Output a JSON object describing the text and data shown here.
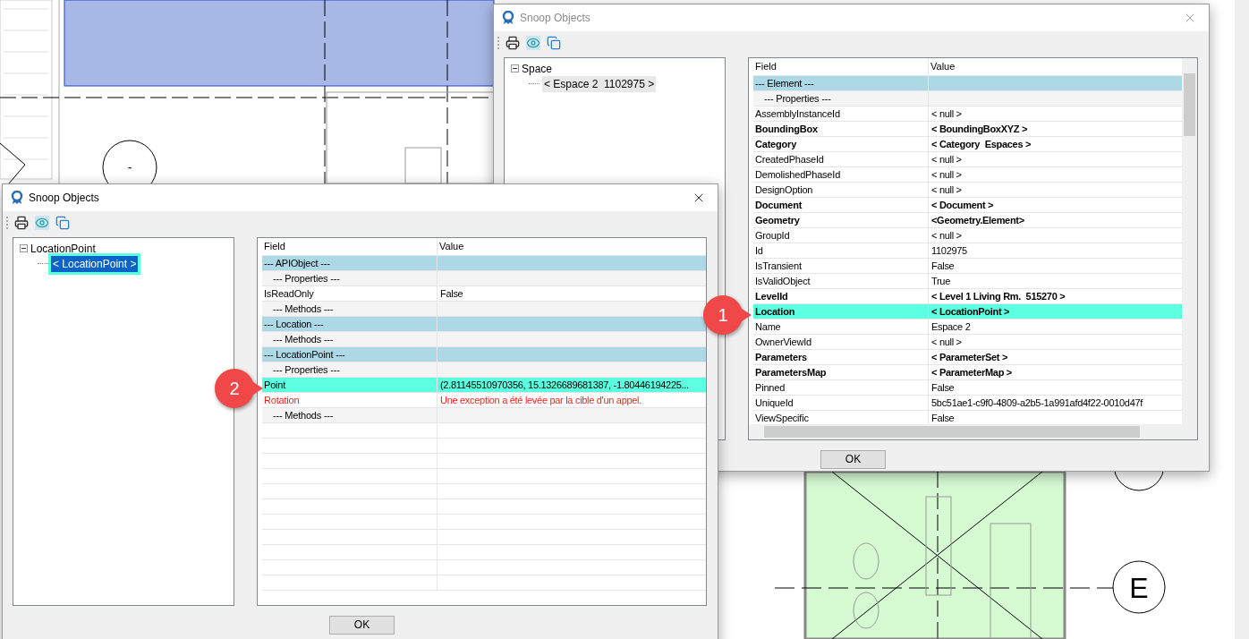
{
  "windows": [
    {
      "title": "Snoop Objects",
      "active": false,
      "tree": [
        {
          "label": "Space",
          "expanded": true,
          "children": [
            {
              "label": "< Espace 2  1102975 >",
              "selected": true
            }
          ]
        }
      ],
      "columns": [
        "Field",
        "Value"
      ],
      "rows": [
        {
          "kind": "section",
          "field": "--- Element ---",
          "value": "",
          "bold": false,
          "error": false,
          "highlighted": false
        },
        {
          "kind": "group",
          "field": "--- Properties ---",
          "value": "",
          "bold": false,
          "error": false,
          "highlighted": false
        },
        {
          "kind": "field",
          "field": "AssemblyInstanceId",
          "value": "< null >",
          "bold": false,
          "error": false,
          "highlighted": false
        },
        {
          "kind": "field",
          "field": "BoundingBox",
          "value": "< BoundingBoxXYZ >",
          "bold": true,
          "error": false,
          "highlighted": false
        },
        {
          "kind": "field",
          "field": "Category",
          "value": "< Category  Espaces >",
          "bold": true,
          "error": false,
          "highlighted": false
        },
        {
          "kind": "field",
          "field": "CreatedPhaseId",
          "value": "< null >",
          "bold": false,
          "error": false,
          "highlighted": false
        },
        {
          "kind": "field",
          "field": "DemolishedPhaseId",
          "value": "< null >",
          "bold": false,
          "error": false,
          "highlighted": false
        },
        {
          "kind": "field",
          "field": "DesignOption",
          "value": "< null >",
          "bold": false,
          "error": false,
          "highlighted": false
        },
        {
          "kind": "field",
          "field": "Document",
          "value": "< Document >",
          "bold": true,
          "error": false,
          "highlighted": false
        },
        {
          "kind": "field",
          "field": "Geometry",
          "value": "<Geometry.Element>",
          "bold": true,
          "error": false,
          "highlighted": false
        },
        {
          "kind": "field",
          "field": "GroupId",
          "value": "< null >",
          "bold": false,
          "error": false,
          "highlighted": false
        },
        {
          "kind": "field",
          "field": "Id",
          "value": "1102975",
          "bold": false,
          "error": false,
          "highlighted": false
        },
        {
          "kind": "field",
          "field": "IsTransient",
          "value": "False",
          "bold": false,
          "error": false,
          "highlighted": false
        },
        {
          "kind": "field",
          "field": "IsValidObject",
          "value": "True",
          "bold": false,
          "error": false,
          "highlighted": false
        },
        {
          "kind": "field",
          "field": "LevelId",
          "value": "< Level 1 Living Rm.  515270 >",
          "bold": true,
          "error": false,
          "highlighted": false
        },
        {
          "kind": "field",
          "field": "Location",
          "value": "< LocationPoint >",
          "bold": true,
          "error": false,
          "highlighted": true
        },
        {
          "kind": "field",
          "field": "Name",
          "value": "Espace 2",
          "bold": false,
          "error": false,
          "highlighted": false
        },
        {
          "kind": "field",
          "field": "OwnerViewId",
          "value": "< null >",
          "bold": false,
          "error": false,
          "highlighted": false
        },
        {
          "kind": "field",
          "field": "Parameters",
          "value": "< ParameterSet >",
          "bold": true,
          "error": false,
          "highlighted": false
        },
        {
          "kind": "field",
          "field": "ParametersMap",
          "value": "< ParameterMap >",
          "bold": true,
          "error": false,
          "highlighted": false
        },
        {
          "kind": "field",
          "field": "Pinned",
          "value": "False",
          "bold": false,
          "error": false,
          "highlighted": false
        },
        {
          "kind": "field",
          "field": "UniqueId",
          "value": "5bc51ae1-c9f0-4809-a2b5-1a991afd4f22-0010d47f",
          "bold": false,
          "error": false,
          "highlighted": false
        },
        {
          "kind": "field",
          "field": "ViewSpecific",
          "value": "False",
          "bold": false,
          "error": false,
          "highlighted": false
        }
      ],
      "button": "OK"
    },
    {
      "title": "Snoop Objects",
      "active": true,
      "tree": [
        {
          "label": "LocationPoint",
          "expanded": true,
          "children": [
            {
              "label": "< LocationPoint >",
              "selected": true
            }
          ]
        }
      ],
      "columns": [
        "Field",
        "Value"
      ],
      "rows": [
        {
          "kind": "section",
          "field": "--- APIObject ---",
          "value": "",
          "bold": false,
          "error": false,
          "highlighted": false
        },
        {
          "kind": "group",
          "field": "--- Properties ---",
          "value": "",
          "bold": false,
          "error": false,
          "highlighted": false
        },
        {
          "kind": "field",
          "field": "IsReadOnly",
          "value": "False",
          "bold": false,
          "error": false,
          "highlighted": false
        },
        {
          "kind": "group",
          "field": "--- Methods ---",
          "value": "",
          "bold": false,
          "error": false,
          "highlighted": false
        },
        {
          "kind": "section",
          "field": "--- Location ---",
          "value": "",
          "bold": false,
          "error": false,
          "highlighted": false
        },
        {
          "kind": "group",
          "field": "--- Methods ---",
          "value": "",
          "bold": false,
          "error": false,
          "highlighted": false
        },
        {
          "kind": "section",
          "field": "--- LocationPoint ---",
          "value": "",
          "bold": false,
          "error": false,
          "highlighted": false
        },
        {
          "kind": "group",
          "field": "--- Properties ---",
          "value": "",
          "bold": false,
          "error": false,
          "highlighted": false
        },
        {
          "kind": "field",
          "field": "Point",
          "value": "(2.81145510970356, 15.1326689681387, -1.80446194225...",
          "bold": false,
          "error": false,
          "highlighted": true
        },
        {
          "kind": "field",
          "field": "Rotation",
          "value": "Une exception a été levée par la cible d'un appel.",
          "bold": false,
          "error": true,
          "highlighted": false
        },
        {
          "kind": "group",
          "field": "--- Methods ---",
          "value": "",
          "bold": false,
          "error": false,
          "highlighted": false
        }
      ],
      "button": "OK"
    }
  ],
  "callouts": [
    "1",
    "2"
  ],
  "drawing": {
    "grid_bubbles": [
      "-",
      "E"
    ]
  }
}
